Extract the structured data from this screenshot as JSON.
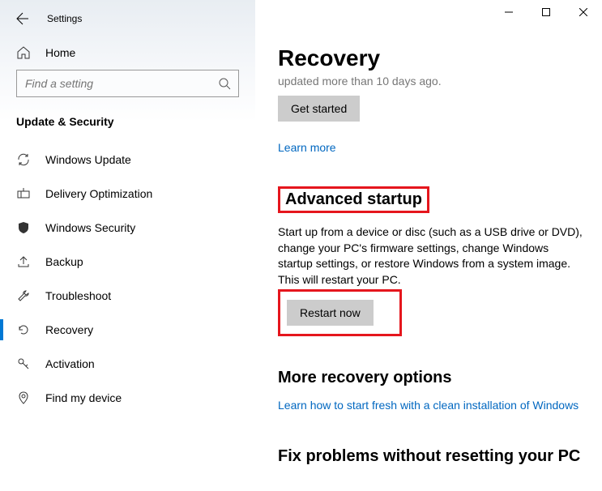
{
  "app_title": "Settings",
  "home_label": "Home",
  "search": {
    "placeholder": "Find a setting"
  },
  "category": "Update & Security",
  "sidebar": {
    "items": [
      {
        "label": "Windows Update"
      },
      {
        "label": "Delivery Optimization"
      },
      {
        "label": "Windows Security"
      },
      {
        "label": "Backup"
      },
      {
        "label": "Troubleshoot"
      },
      {
        "label": "Recovery"
      },
      {
        "label": "Activation"
      },
      {
        "label": "Find my device"
      }
    ]
  },
  "page": {
    "title": "Recovery",
    "truncated_line": "updated more than 10 days ago.",
    "get_started": "Get started",
    "learn_more": "Learn more",
    "advanced_startup_title": "Advanced startup",
    "advanced_startup_body": "Start up from a device or disc (such as a USB drive or DVD), change your PC's firmware settings, change Windows startup settings, or restore Windows from a system image. This will restart your PC.",
    "restart_now": "Restart now",
    "more_options_title": "More recovery options",
    "fresh_link": "Learn how to start fresh with a clean installation of Windows",
    "fix_title": "Fix problems without resetting your PC"
  }
}
